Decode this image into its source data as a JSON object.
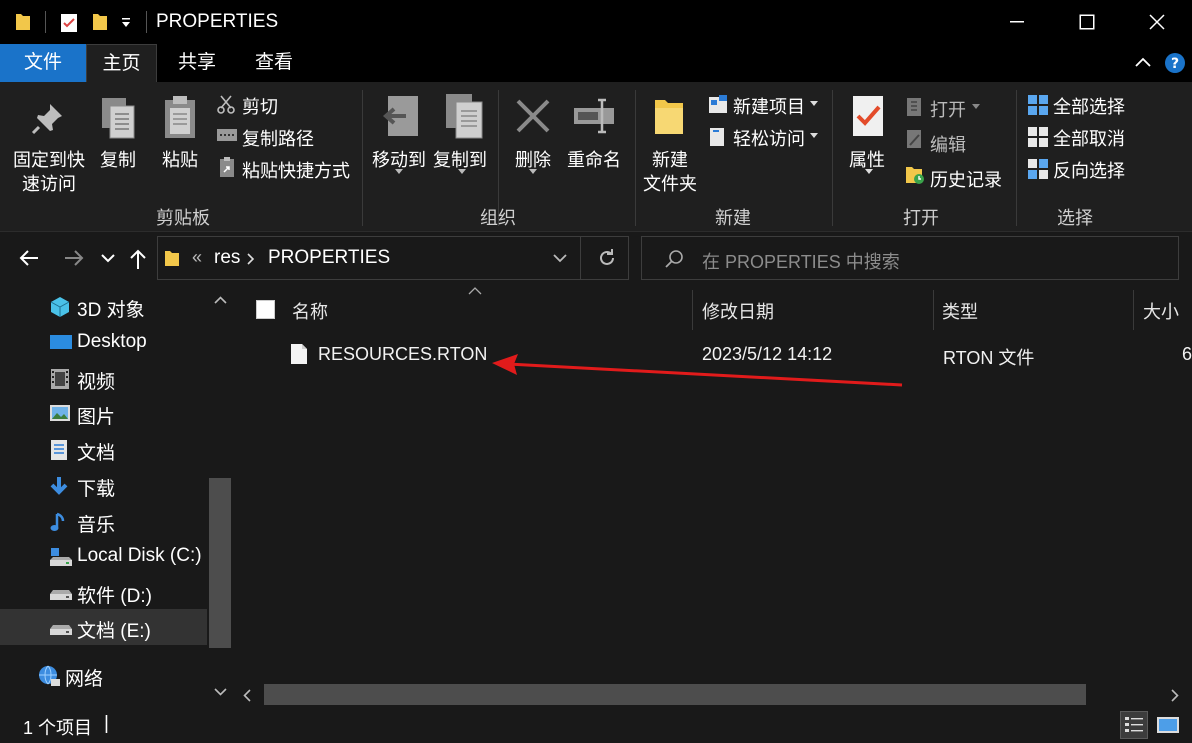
{
  "window": {
    "title": "PROPERTIES"
  },
  "ribbon_tabs": [
    {
      "label": "文件"
    },
    {
      "label": "主页"
    },
    {
      "label": "共享"
    },
    {
      "label": "查看"
    }
  ],
  "ribbon": {
    "clipboard": {
      "pin_line1": "固定到快",
      "pin_line2": "速访问",
      "copy": "复制",
      "paste": "粘贴",
      "cut": "剪切",
      "copy_path": "复制路径",
      "paste_shortcut": "粘贴快捷方式",
      "group": "剪贴板"
    },
    "organize": {
      "move_to": "移动到",
      "copy_to": "复制到",
      "delete": "删除",
      "rename": "重命名",
      "group": "组织"
    },
    "new": {
      "new_folder_line1": "新建",
      "new_folder_line2": "文件夹",
      "new_item": "新建项目",
      "easy_access": "轻松访问",
      "group": "新建"
    },
    "open": {
      "properties": "属性",
      "open": "打开",
      "edit": "编辑",
      "history": "历史记录",
      "group": "打开"
    },
    "select": {
      "select_all": "全部选择",
      "select_none": "全部取消",
      "invert": "反向选择",
      "group": "选择"
    }
  },
  "address": {
    "overflow": "«",
    "crumbs": [
      "res",
      "PROPERTIES"
    ],
    "search_placeholder": "在 PROPERTIES 中搜索"
  },
  "sidebar": {
    "items": [
      {
        "label": "3D 对象",
        "icon": "3d-objects-icon"
      },
      {
        "label": "Desktop",
        "icon": "desktop-icon"
      },
      {
        "label": "视频",
        "icon": "videos-icon"
      },
      {
        "label": "图片",
        "icon": "pictures-icon"
      },
      {
        "label": "文档",
        "icon": "documents-icon"
      },
      {
        "label": "下载",
        "icon": "downloads-icon"
      },
      {
        "label": "音乐",
        "icon": "music-icon"
      },
      {
        "label": "Local Disk (C:)",
        "icon": "system-drive-icon"
      },
      {
        "label": "软件 (D:)",
        "icon": "drive-icon"
      },
      {
        "label": "文档 (E:)",
        "icon": "drive-icon",
        "selected": true
      },
      {
        "label": "网络",
        "icon": "network-icon"
      }
    ]
  },
  "file_list": {
    "columns": [
      "名称",
      "修改日期",
      "类型",
      "大小"
    ],
    "rows": [
      {
        "name": "RESOURCES.RTON",
        "modified": "2023/5/12 14:12",
        "type": "RTON 文件",
        "size": "6"
      }
    ]
  },
  "status": {
    "count": "1 个项目",
    "cursor": "|"
  },
  "colors": {
    "accent": "#1a73c9",
    "annotation_arrow": "#e11b1b"
  }
}
